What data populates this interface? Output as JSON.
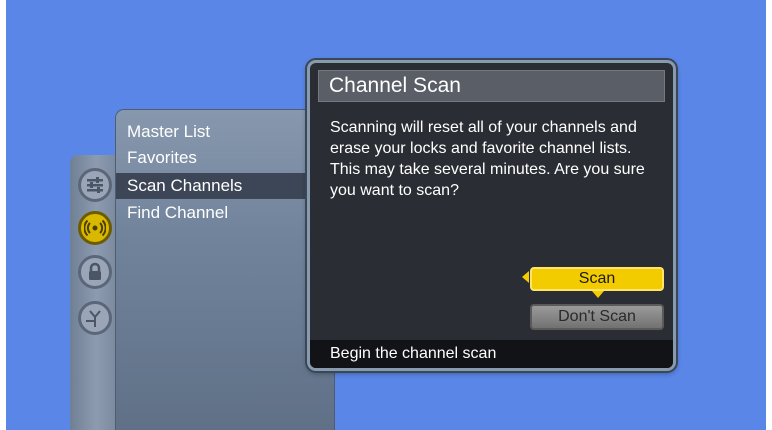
{
  "menu": {
    "items": [
      {
        "label": "Master List"
      },
      {
        "label": "Favorites"
      },
      {
        "label": "Scan Channels"
      },
      {
        "label": "Find Channel"
      }
    ],
    "selected_index": 2
  },
  "sidebar_icons": [
    {
      "name": "settings-sliders-icon",
      "active": false
    },
    {
      "name": "broadcast-antenna-icon",
      "active": true
    },
    {
      "name": "lock-icon",
      "active": false
    },
    {
      "name": "parental-controls-icon",
      "active": false
    }
  ],
  "dialog": {
    "title": "Channel Scan",
    "message": "Scanning will reset all of your channels and erase your locks and favorite channel lists. This may take several minutes. Are you sure you want to scan?",
    "buttons": {
      "scan": "Scan",
      "dont_scan": "Don't Scan"
    },
    "status": "Begin the channel scan"
  },
  "colors": {
    "background": "#5a86e8",
    "highlight": "#f3cc00",
    "dialog_bg": "#2a2d33"
  }
}
